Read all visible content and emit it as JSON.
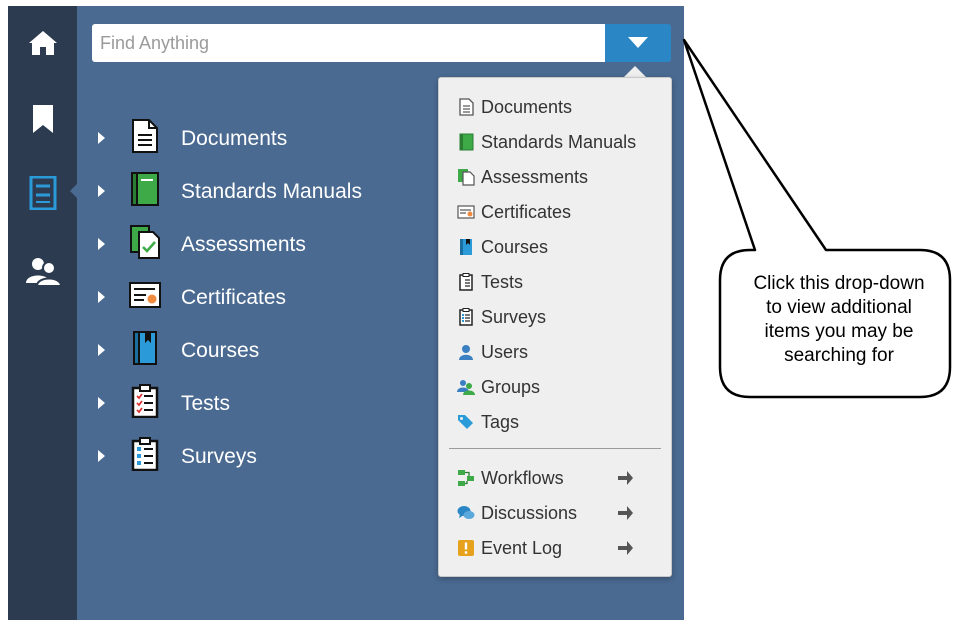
{
  "search": {
    "placeholder": "Find Anything"
  },
  "rail": {
    "items": [
      {
        "icon": "home-icon"
      },
      {
        "icon": "bookmark-icon"
      },
      {
        "icon": "library-icon",
        "active": true
      },
      {
        "icon": "users-icon"
      }
    ]
  },
  "tree": {
    "items": [
      {
        "label": "Documents",
        "icon": "document-icon"
      },
      {
        "label": "Standards Manuals",
        "icon": "standards-manual-icon"
      },
      {
        "label": "Assessments",
        "icon": "assessment-icon"
      },
      {
        "label": "Certificates",
        "icon": "certificate-icon"
      },
      {
        "label": "Courses",
        "icon": "course-icon"
      },
      {
        "label": "Tests",
        "icon": "test-icon"
      },
      {
        "label": "Surveys",
        "icon": "survey-icon"
      }
    ]
  },
  "dropdown": {
    "items": [
      {
        "label": "Documents",
        "icon": "document-icon"
      },
      {
        "label": "Standards Manuals",
        "icon": "standards-manual-icon"
      },
      {
        "label": "Assessments",
        "icon": "assessment-icon"
      },
      {
        "label": "Certificates",
        "icon": "certificate-icon"
      },
      {
        "label": "Courses",
        "icon": "course-icon"
      },
      {
        "label": "Tests",
        "icon": "test-icon"
      },
      {
        "label": "Surveys",
        "icon": "survey-icon"
      },
      {
        "label": "Users",
        "icon": "user-icon"
      },
      {
        "label": "Groups",
        "icon": "groups-icon"
      },
      {
        "label": "Tags",
        "icon": "tag-icon"
      }
    ],
    "links": [
      {
        "label": "Workflows",
        "icon": "workflow-icon"
      },
      {
        "label": "Discussions",
        "icon": "discussion-icon"
      },
      {
        "label": "Event Log",
        "icon": "event-log-icon"
      }
    ]
  },
  "callout": {
    "lines": [
      "Click this drop-down",
      "to view additional",
      "items you may be",
      "searching for"
    ]
  },
  "colors": {
    "panel": "#4a6a91",
    "rail": "#2c3b4f",
    "accent": "#2a86c4",
    "dropdown": "#efefef"
  }
}
